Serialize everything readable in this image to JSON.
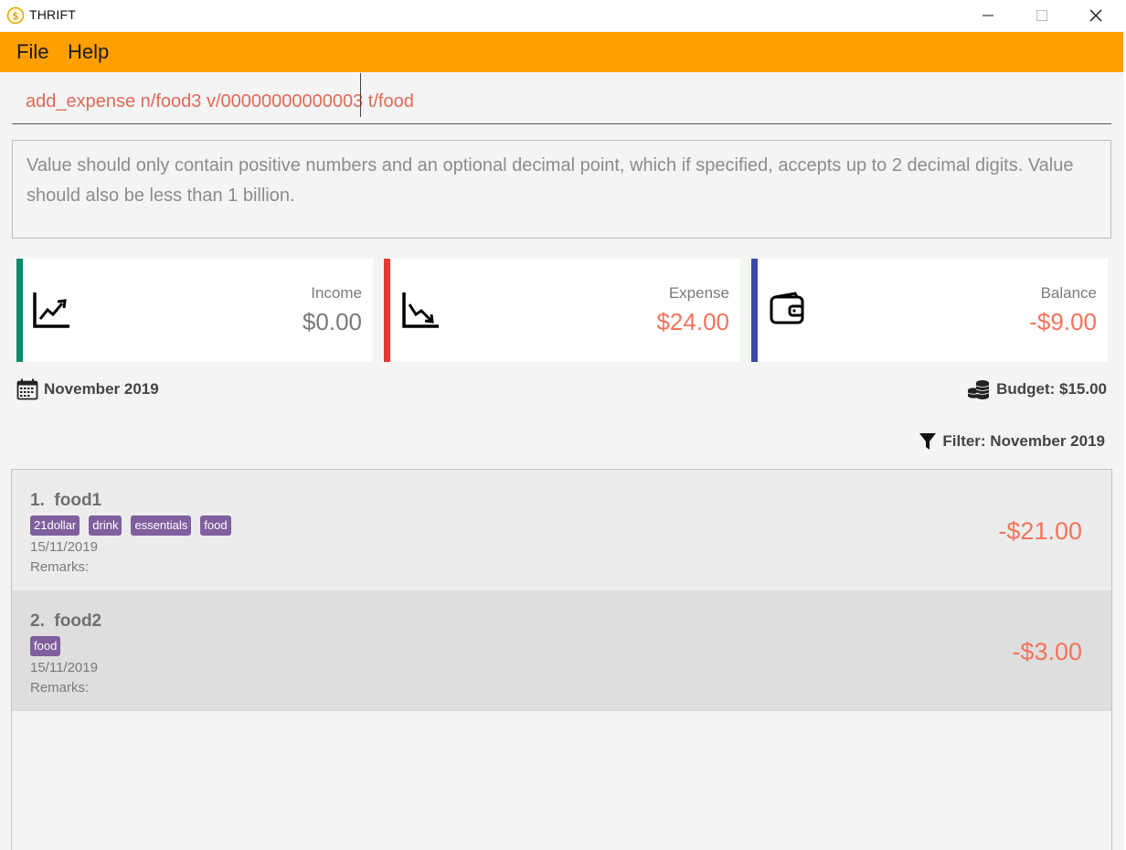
{
  "window": {
    "title": "THRIFT",
    "minimize_glyph": "—",
    "maximize_glyph": "☐",
    "close_glyph": "✕"
  },
  "menu": {
    "items": [
      "File",
      "Help"
    ]
  },
  "command": {
    "value": "add_expense n/food3 v/00000000000003 t/food"
  },
  "result": {
    "message": "Value should only contain positive numbers and an optional decimal point, which if specified, accepts up to 2 decimal digits. Value should also be less than 1 billion."
  },
  "summary": {
    "income": {
      "label": "Income",
      "amount": "$0.00",
      "accent": "#0e8a6e",
      "amount_color": "#7a7a7a",
      "icon": "trending-up-icon"
    },
    "expense": {
      "label": "Expense",
      "amount": "$24.00",
      "accent": "#e53935",
      "amount_color": "#f4735b",
      "icon": "trending-down-icon"
    },
    "balance": {
      "label": "Balance",
      "amount": "-$9.00",
      "accent": "#3949ab",
      "amount_color": "#f4735b",
      "icon": "wallet-icon"
    }
  },
  "month": {
    "label": "November 2019"
  },
  "budget": {
    "label": "Budget: $15.00"
  },
  "filter": {
    "label": "Filter: November 2019"
  },
  "transactions": [
    {
      "title": "1.  food1",
      "tags": [
        "21dollar",
        "drink",
        "essentials",
        "food"
      ],
      "date": "15/11/2019",
      "remarks": "Remarks:",
      "value": "-$21.00",
      "bg": "#ececec"
    },
    {
      "title": "2.  food2",
      "tags": [
        "food"
      ],
      "date": "15/11/2019",
      "remarks": "Remarks:",
      "value": "-$3.00",
      "bg": "#dedede"
    }
  ]
}
